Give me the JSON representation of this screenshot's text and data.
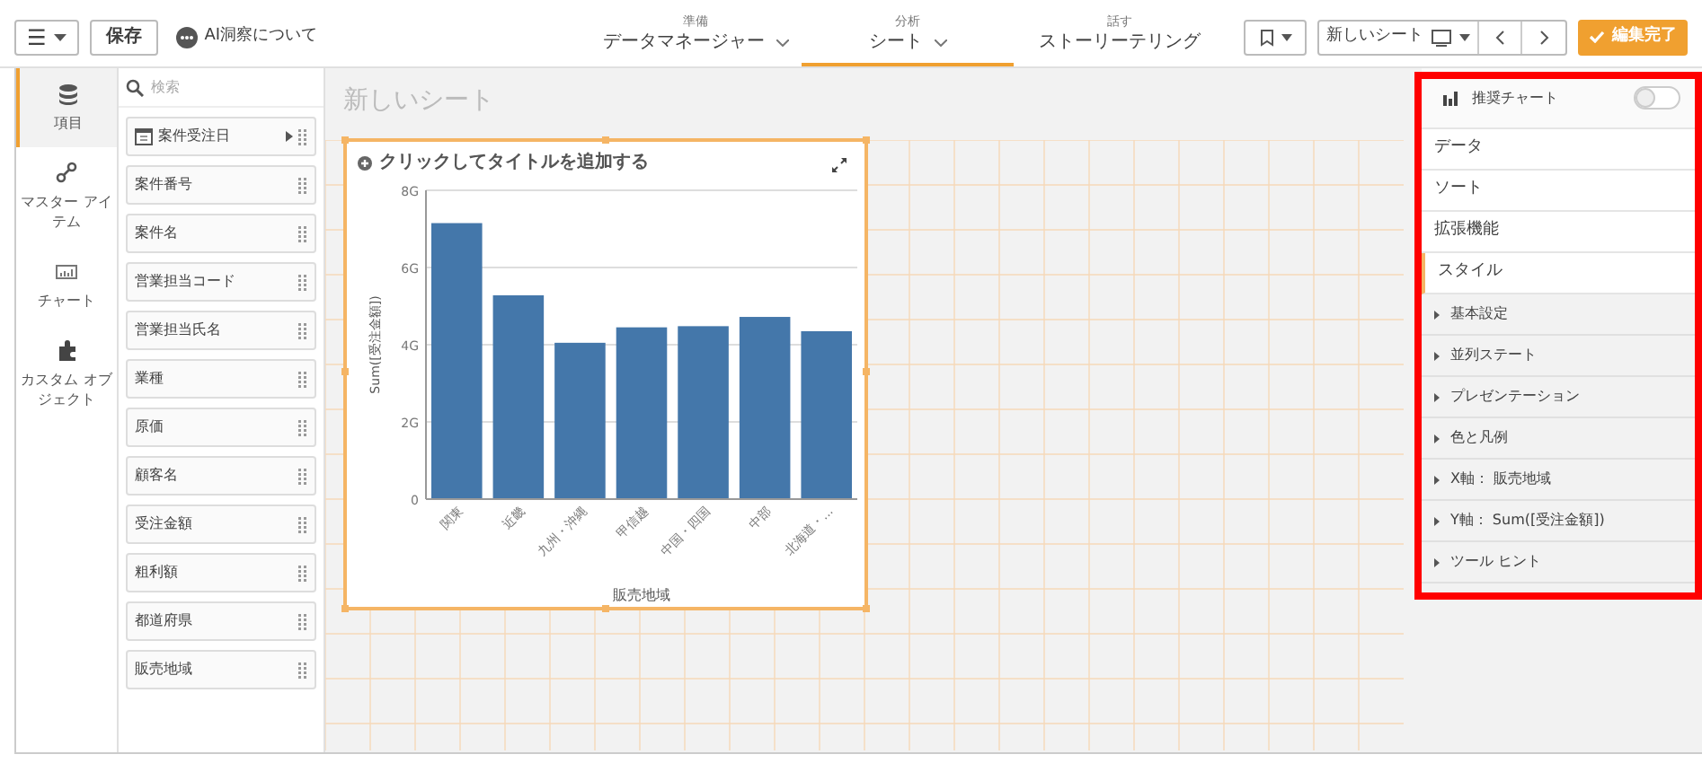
{
  "toolbar": {
    "menu_button": "☰",
    "save_button": "保存",
    "ai_link": "AI洞察について"
  },
  "tabs": [
    {
      "caption": "準備",
      "label": "データマネージャー",
      "selected": false,
      "dropdown": true
    },
    {
      "caption": "分析",
      "label": "シート",
      "selected": true,
      "dropdown": true
    },
    {
      "caption": "話す",
      "label": "ストーリーテリング",
      "selected": false,
      "dropdown": false
    }
  ],
  "sheet_button": "新しいシート",
  "done_button": "編集完了",
  "nav": [
    {
      "kind": "fields",
      "label": "項目",
      "selected": true
    },
    {
      "kind": "master",
      "label": "マスター アイテム",
      "selected": false
    },
    {
      "kind": "charts",
      "label": "チャート",
      "selected": false
    },
    {
      "kind": "custom",
      "label": "カスタム オブジェクト",
      "selected": false
    }
  ],
  "search": {
    "placeholder": "検索"
  },
  "fields": [
    {
      "kind": "date",
      "label": "案件受注日"
    },
    {
      "kind": "plain",
      "label": "案件番号"
    },
    {
      "kind": "plain",
      "label": "案件名"
    },
    {
      "kind": "plain",
      "label": "営業担当コード"
    },
    {
      "kind": "plain",
      "label": "営業担当氏名"
    },
    {
      "kind": "plain",
      "label": "業種"
    },
    {
      "kind": "plain",
      "label": "原価"
    },
    {
      "kind": "plain",
      "label": "顧客名"
    },
    {
      "kind": "plain",
      "label": "受注金額"
    },
    {
      "kind": "plain",
      "label": "粗利額"
    },
    {
      "kind": "plain",
      "label": "都道府県"
    },
    {
      "kind": "plain",
      "label": "販売地域"
    }
  ],
  "sheet": {
    "title": "新しいシート",
    "card": {
      "title": "クリックしてタイトルを追加する",
      "chart_data": {
        "type": "bar",
        "xlabel": "販売地域",
        "ylabel": "Sum([受注金額])",
        "categories": [
          "関東",
          "近畿",
          "九州・沖縄",
          "甲信越",
          "中国・四国",
          "中部",
          "北海道・..."
        ],
        "values": [
          7.15,
          5.28,
          4.05,
          4.45,
          4.48,
          4.72,
          4.35
        ],
        "grid": true,
        "ylim": [
          0,
          8
        ],
        "yticks": [
          {
            "value": 0,
            "label": "0"
          },
          {
            "value": 2,
            "label": "2G"
          },
          {
            "value": 4,
            "label": "4G"
          },
          {
            "value": 6,
            "label": "6G"
          },
          {
            "value": 8,
            "label": "8G"
          }
        ]
      }
    }
  },
  "panel": {
    "header": {
      "label": "推奨チャート",
      "on": false
    },
    "sections": [
      {
        "label": "データ",
        "selected": false
      },
      {
        "label": "ソート",
        "selected": false
      },
      {
        "label": "拡張機能",
        "selected": false
      },
      {
        "label": "スタイル",
        "selected": true
      }
    ],
    "style_items": [
      "基本設定",
      "並列ステート",
      "プレゼンテーション",
      "色と凡例",
      "X軸： 販売地域",
      "Y軸： Sum([受注金額])",
      "ツール ヒント"
    ]
  }
}
